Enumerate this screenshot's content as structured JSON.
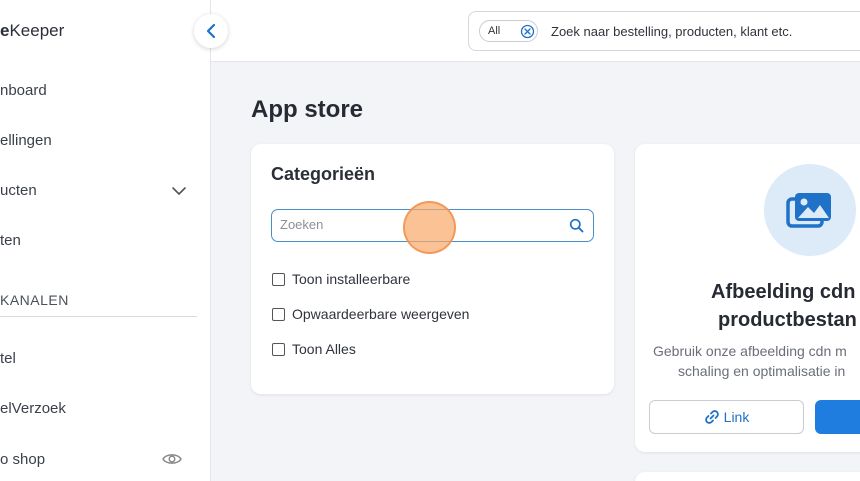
{
  "app": {
    "logo_prefix": "e",
    "logo_suffix": "Keeper"
  },
  "sidebar": {
    "items": [
      {
        "label": "nboard"
      },
      {
        "label": "ellingen"
      },
      {
        "label": "ucten"
      },
      {
        "label": "ten"
      }
    ],
    "section_label": "KANALEN",
    "channel_items": [
      {
        "label": "tel"
      },
      {
        "label": "elVerzoek"
      },
      {
        "label": "o shop"
      }
    ]
  },
  "topbar": {
    "scope": "All",
    "search_text": "Zoek naar bestelling, producten, klant etc."
  },
  "main": {
    "title": "App store",
    "categories": {
      "title": "Categorieën",
      "search_placeholder": "Zoeken",
      "filters": [
        {
          "label": "Toon installeerbare",
          "checked": false
        },
        {
          "label": "Opwaardeerbare weergeven",
          "checked": false
        },
        {
          "label": "Toon Alles",
          "checked": false
        }
      ]
    },
    "app_card": {
      "icon": "images-icon",
      "name_line1": "Afbeelding cdn",
      "name_line2": "productbestan",
      "desc_line1": "Gebruik onze afbeelding cdn m",
      "desc_line2": "schaling en optimalisatie in",
      "link_label": "Link"
    }
  },
  "colors": {
    "accent": "#1f7de0",
    "link": "#1f72c8",
    "icon_bg": "#ddeaf8",
    "click_marker": "#f8a868"
  }
}
